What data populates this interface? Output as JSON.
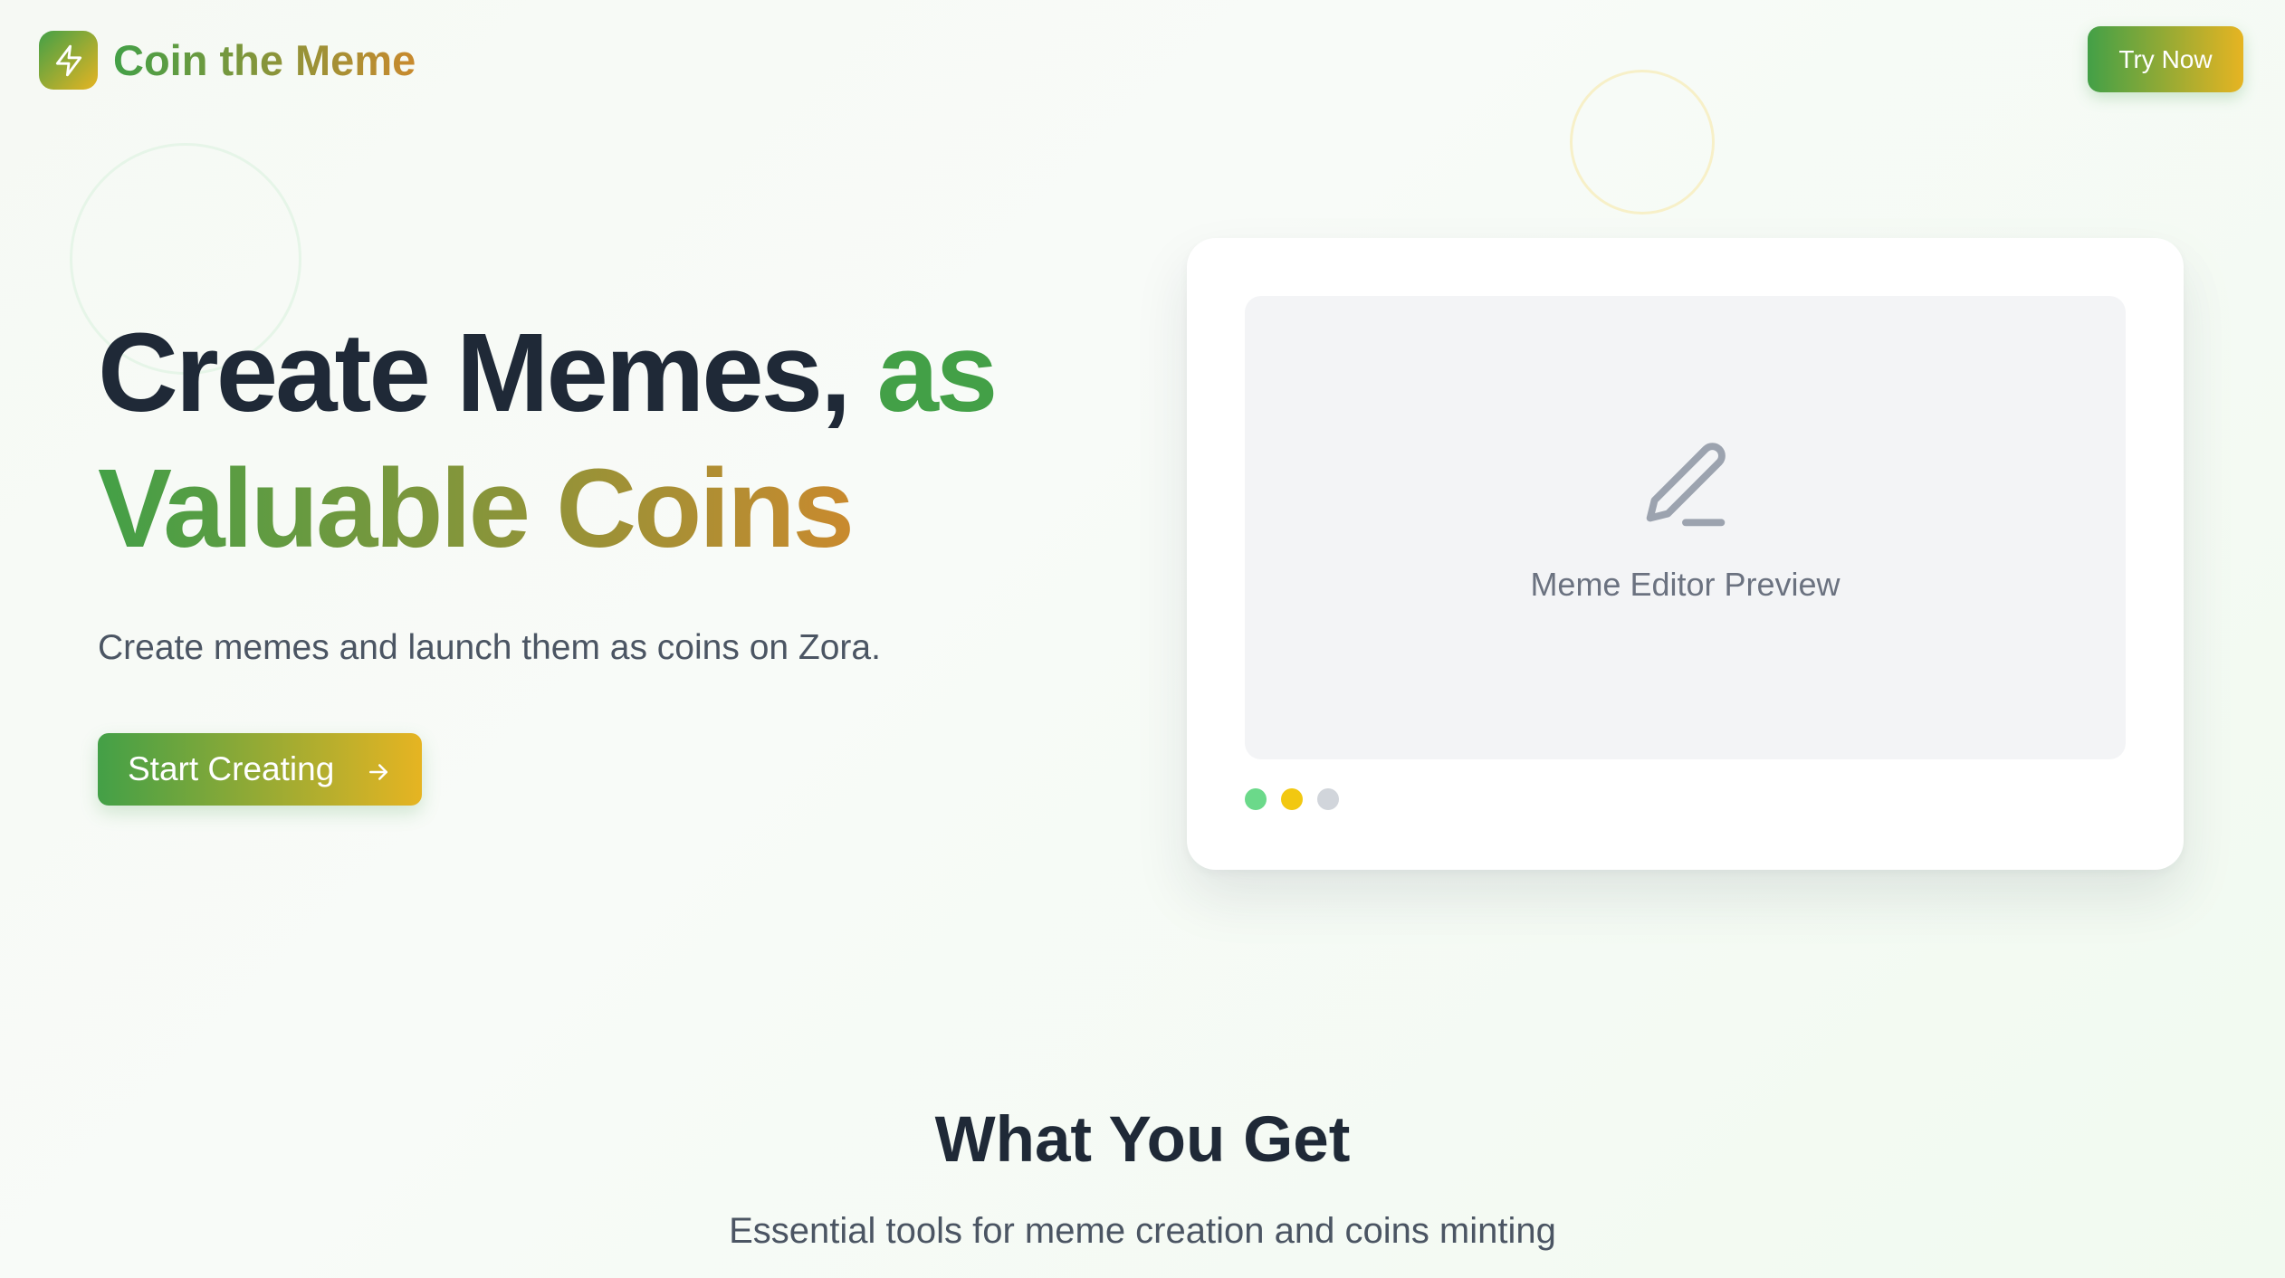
{
  "brand": {
    "name": "Coin the Meme",
    "icon": "lightning-bolt-icon"
  },
  "header": {
    "try_now_label": "Try Now"
  },
  "hero": {
    "title_line1": "Create Memes,",
    "title_accent": "as",
    "title_line2": "Valuable Coins",
    "subtitle": "Create memes and launch them as coins on Zora.",
    "cta_label": "Start Creating",
    "cta_icon": "arrow-right-icon"
  },
  "preview": {
    "icon": "pencil-icon",
    "label": "Meme Editor Preview",
    "dots": [
      "green",
      "yellow",
      "gray"
    ]
  },
  "section": {
    "title": "What You Get",
    "subtitle": "Essential tools for meme creation and coins minting"
  },
  "colors": {
    "brand_green": "#43a047",
    "brand_gold": "#e6b422",
    "text_dark": "#1f2937",
    "text_muted": "#4b5563"
  }
}
